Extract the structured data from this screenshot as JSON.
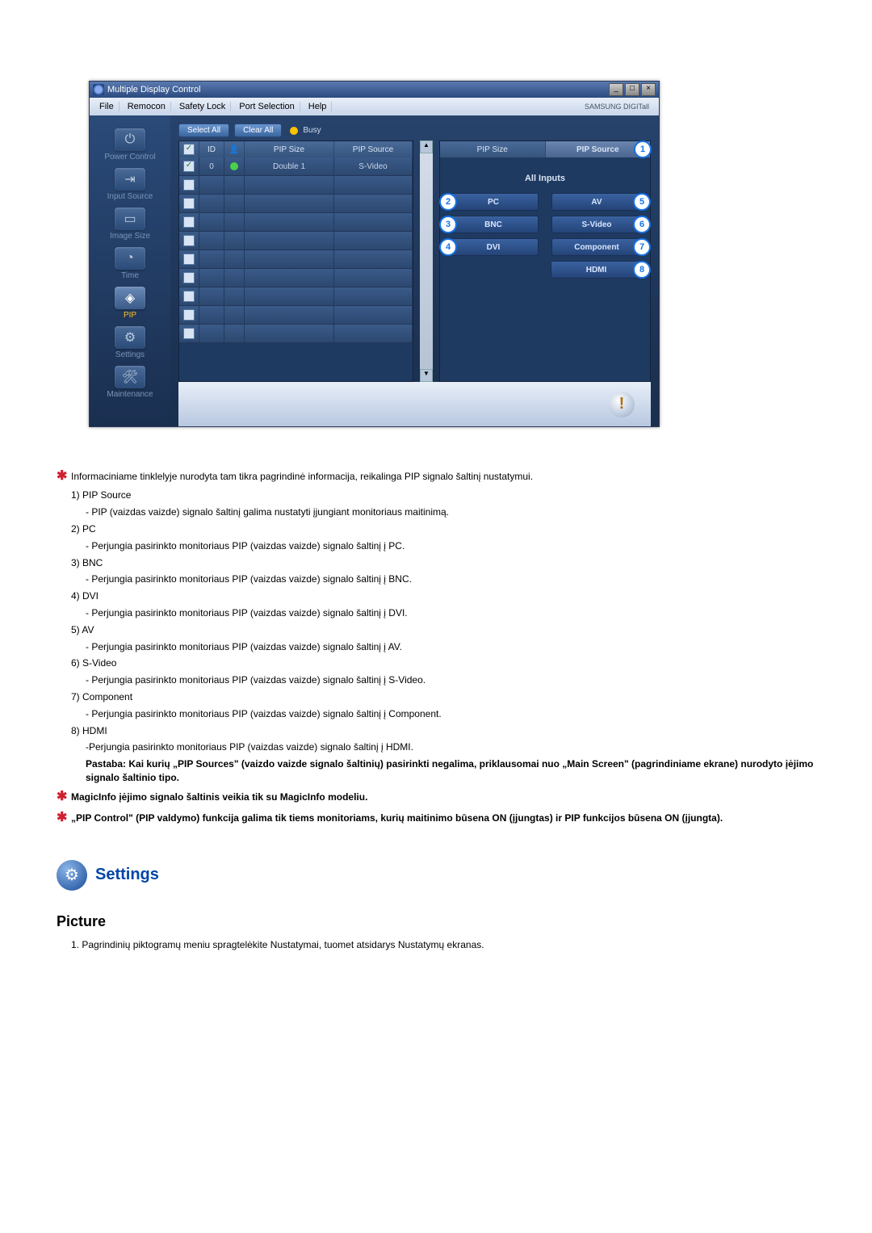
{
  "window": {
    "title": "Multiple Display Control",
    "brand": "SAMSUNG DIGITall"
  },
  "menu": {
    "file": "File",
    "remocon": "Remocon",
    "safety_lock": "Safety Lock",
    "port_selection": "Port Selection",
    "help": "Help"
  },
  "sidebar": {
    "power": "Power Control",
    "input": "Input Source",
    "image": "Image Size",
    "time": "Time",
    "pip": "PIP",
    "settings": "Settings",
    "maint": "Maintenance"
  },
  "buttons": {
    "select_all": "Select All",
    "clear_all": "Clear All",
    "busy": "Busy"
  },
  "table": {
    "h_id": "ID",
    "h_size": "PIP Size",
    "h_src": "PIP Source",
    "row0_id": "0",
    "row0_size": "Double 1",
    "row0_src": "S-Video"
  },
  "panel": {
    "h_size": "PIP Size",
    "h_src": "PIP Source",
    "all_inputs": "All Inputs",
    "pc": "PC",
    "bnc": "BNC",
    "dvi": "DVI",
    "av": "AV",
    "svideo": "S-Video",
    "component": "Component",
    "hdmi": "HDMI",
    "n1": "1",
    "n2": "2",
    "n3": "3",
    "n4": "4",
    "n5": "5",
    "n6": "6",
    "n7": "7",
    "n8": "8"
  },
  "doc": {
    "l_star1": "Informaciniame tinklelyje nurodyta tam tikra pagrindinė informacija, reikalinga PIP signalo šaltinį nustatymui.",
    "l1a": "1)  PIP Source",
    "l1b": "- PIP (vaizdas vaizde) signalo šaltinį galima nustatyti įjungiant monitoriaus maitinimą.",
    "l2a": "2)  PC",
    "l2b": "- Perjungia pasirinkto monitoriaus PIP (vaizdas vaizde) signalo šaltinį į PC.",
    "l3a": "3)  BNC",
    "l3b": "- Perjungia pasirinkto monitoriaus PIP (vaizdas vaizde) signalo šaltinį į BNC.",
    "l4a": "4)  DVI",
    "l4b": "- Perjungia pasirinkto monitoriaus PIP (vaizdas vaizde) signalo šaltinį į DVI.",
    "l5a": "5)  AV",
    "l5b": "- Perjungia pasirinkto monitoriaus PIP (vaizdas vaizde) signalo šaltinį į AV.",
    "l6a": "6)  S-Video",
    "l6b": "- Perjungia pasirinkto monitoriaus PIP (vaizdas vaizde) signalo šaltinį į S-Video.",
    "l7a": "7)  Component",
    "l7b": "- Perjungia pasirinkto monitoriaus PIP (vaizdas vaizde) signalo šaltinį į Component.",
    "l8a": "8)  HDMI",
    "l8b": "-Perjungia pasirinkto monitoriaus PIP (vaizdas vaizde) signalo šaltinį į HDMI.",
    "note": "Pastaba: Kai kurių „PIP Sources\" (vaizdo vaizde signalo šaltinių) pasirinkti negalima, priklausomai nuo „Main Screen\" (pagrindiniame ekrane) nurodyto įėjimo signalo šaltinio tipo.",
    "l_star2": "MagicInfo įėjimo signalo šaltinis veikia tik su MagicInfo modeliu.",
    "l_star3": "„PIP Control\" (PIP valdymo) funkcija galima tik tiems monitoriams, kurių maitinimo būsena ON (įjungtas) ir PIP funkcijos būsena ON (įjungta).",
    "settings_h": "Settings",
    "picture_h": "Picture",
    "pic1": "1.  Pagrindinių piktogramų meniu spragtelėkite Nustatymai, tuomet atsidarys Nustatymų ekranas."
  }
}
